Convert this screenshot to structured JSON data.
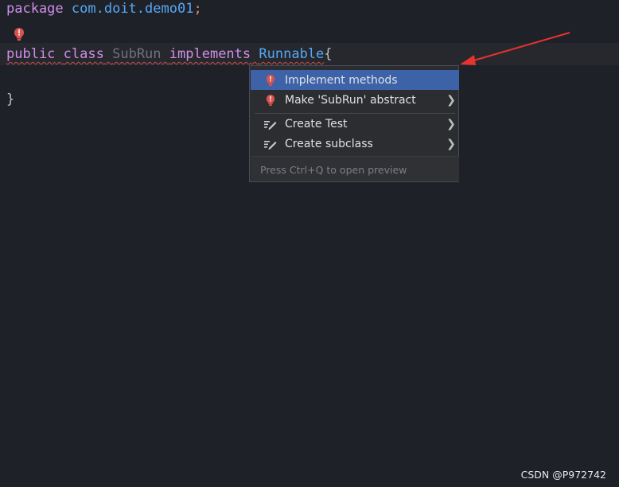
{
  "editor": {
    "line1": {
      "kw": "package",
      "pkg": "com.doit.demo01",
      "semi": ";"
    },
    "line3": {
      "kw_public": "public",
      "kw_class": "class",
      "class_name": "SubRun",
      "kw_implements": "implements",
      "interface": "Runnable",
      "brace": "{"
    },
    "line5": {
      "brace": "}"
    },
    "gutter_icon": "error-bulb-icon"
  },
  "popup": {
    "items": [
      {
        "label": "Implement methods",
        "icon": "error-bulb-icon",
        "submenu": false,
        "selected": true
      },
      {
        "label": "Make 'SubRun' abstract",
        "icon": "error-bulb-icon",
        "submenu": true
      },
      {
        "label": "Create Test",
        "icon": "edit-pencil-icon",
        "submenu": true
      },
      {
        "label": "Create subclass",
        "icon": "edit-pencil-icon",
        "submenu": true
      }
    ],
    "hint": "Press Ctrl+Q to open preview"
  },
  "annotation": {
    "color": "#e5332f"
  },
  "watermark": "CSDN @P972742",
  "colors": {
    "background": "#1f2128",
    "keyword": "#cf8ee8",
    "package": "#56a8f5",
    "selection": "#3d62a8",
    "error": "#c94f4f"
  }
}
